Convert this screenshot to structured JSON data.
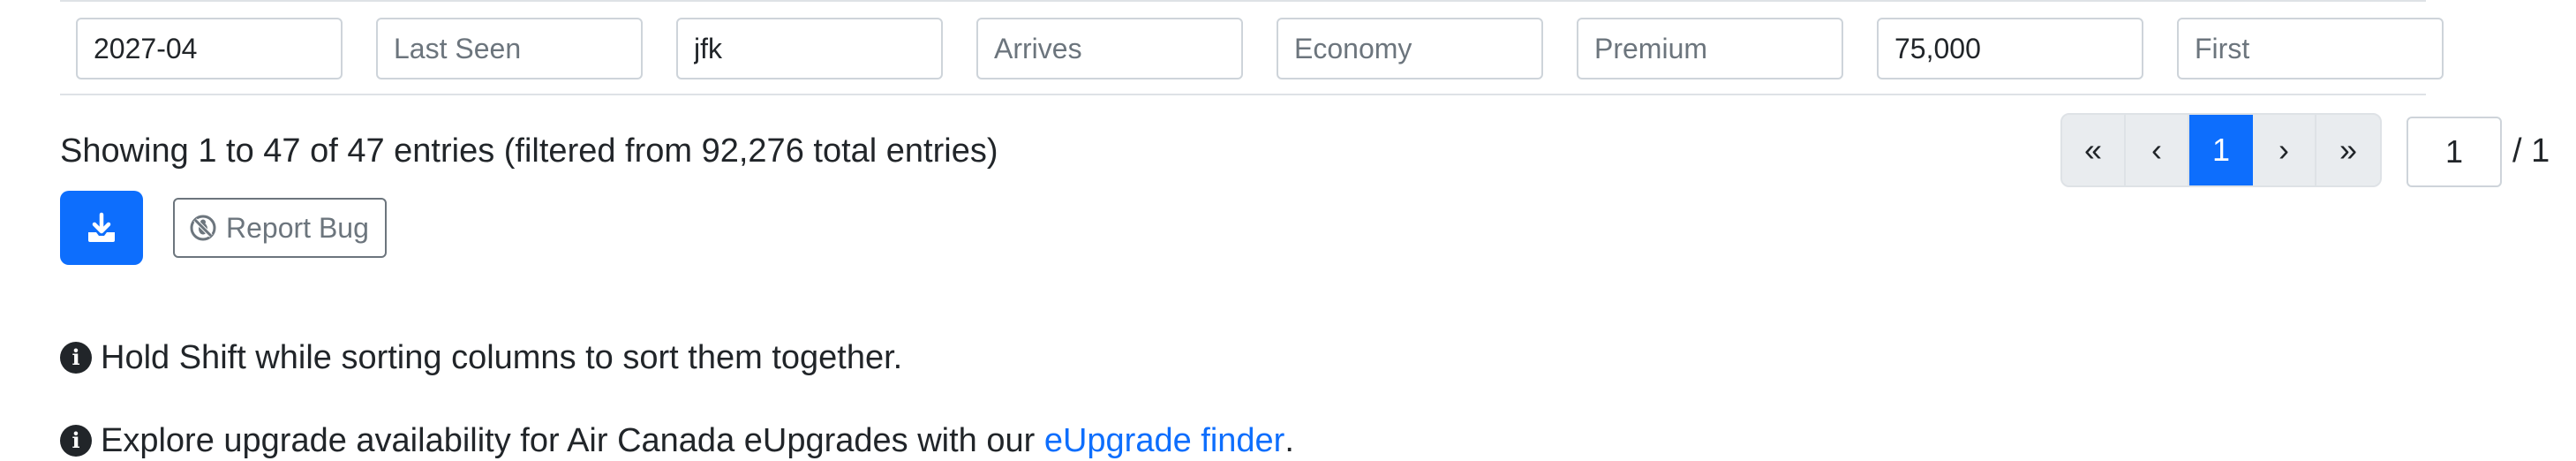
{
  "filters": [
    {
      "name": "month",
      "value": "2027-04",
      "placeholder": ""
    },
    {
      "name": "last-seen",
      "value": "",
      "placeholder": "Last Seen"
    },
    {
      "name": "departs",
      "value": "jfk",
      "placeholder": ""
    },
    {
      "name": "arrives",
      "value": "",
      "placeholder": "Arrives"
    },
    {
      "name": "economy",
      "value": "",
      "placeholder": "Economy"
    },
    {
      "name": "premium",
      "value": "",
      "placeholder": "Premium"
    },
    {
      "name": "business",
      "value": "75,000",
      "placeholder": ""
    },
    {
      "name": "first",
      "value": "",
      "placeholder": "First"
    }
  ],
  "entries_info": "Showing 1 to 47 of 47 entries (filtered from 92,276 total entries)",
  "pagination": {
    "first": "«",
    "prev": "‹",
    "current": "1",
    "next": "›",
    "last": "»",
    "page_input": "1",
    "total": "/ 1"
  },
  "buttons": {
    "download_icon": "download-icon",
    "report_bug_label": "Report Bug",
    "report_bug_icon": "bug-slash-icon"
  },
  "hints": {
    "sort_hint": "Hold Shift while sorting columns to sort them together.",
    "upgrade_prefix": "Explore upgrade availability for Air Canada eUpgrades with our ",
    "upgrade_link": "eUpgrade finder",
    "upgrade_suffix": "."
  },
  "colors": {
    "primary": "#0d6efd",
    "border": "#dee2e6",
    "muted": "#6c757d",
    "text": "#212529"
  }
}
